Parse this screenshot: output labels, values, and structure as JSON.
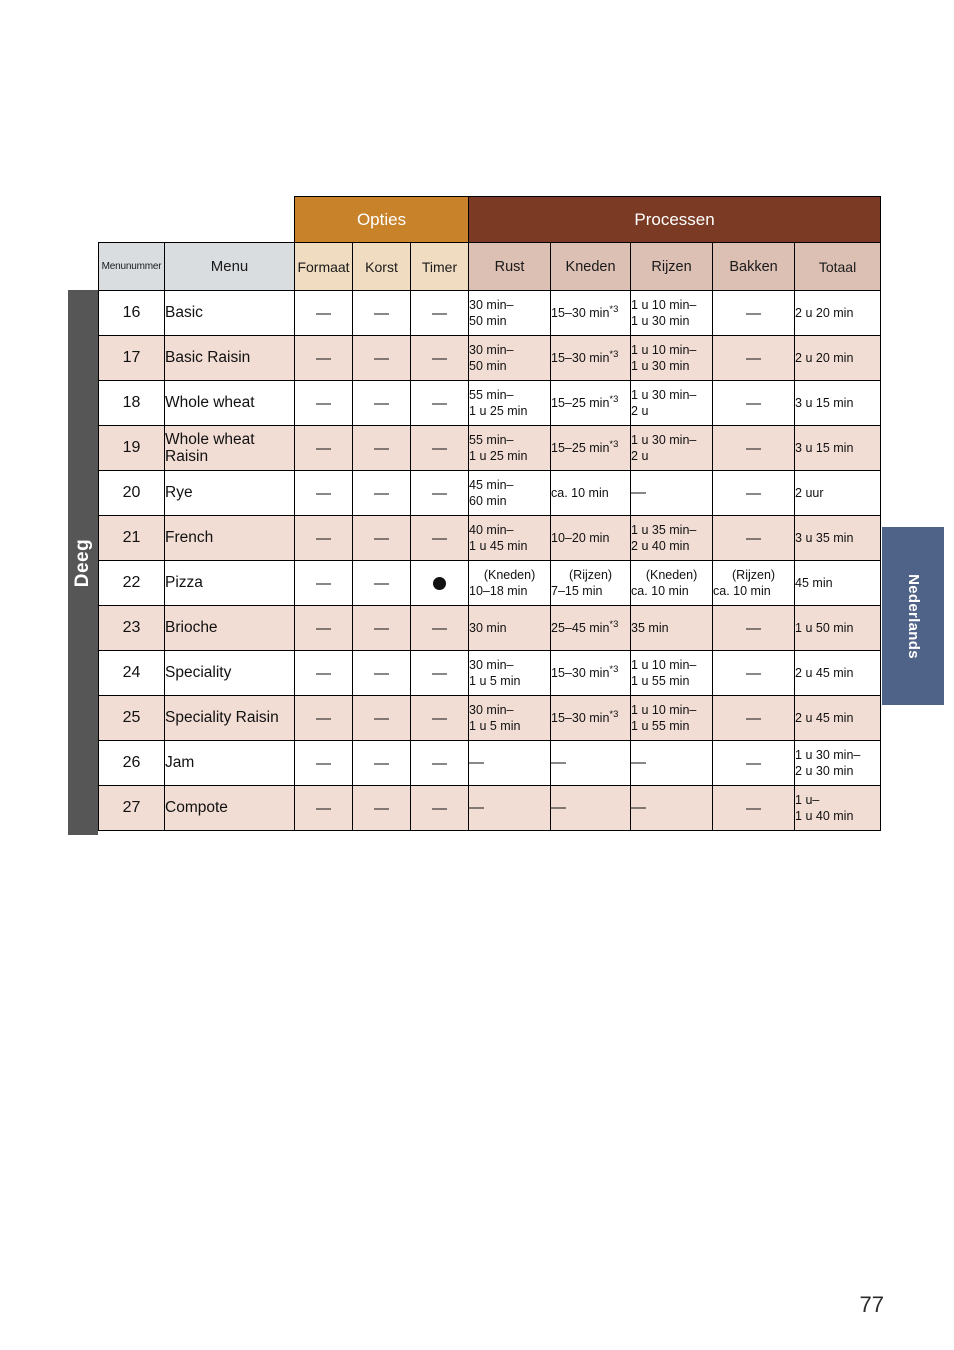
{
  "page": {
    "number": "77",
    "left_tab_label": "Deeg",
    "right_tab_label": "Nederlands",
    "colors": {
      "opties_header": "#c8822a",
      "processen_header": "#7a3a24",
      "menu_header": "#d9dde0",
      "opties_subheader": "#f0dcc0",
      "processen_subheader": "#dcc0b4",
      "row_alt": "#f2ddd5",
      "left_tab": "#565656",
      "right_tab": "#4f6287"
    }
  },
  "table": {
    "group_headers": {
      "blank": "",
      "opties": "Opties",
      "processen": "Processen"
    },
    "columns": [
      {
        "key": "menunummer",
        "label": "Menunummer"
      },
      {
        "key": "menu",
        "label": "Menu"
      },
      {
        "key": "formaat",
        "label": "Formaat"
      },
      {
        "key": "korst",
        "label": "Korst"
      },
      {
        "key": "timer",
        "label": "Timer"
      },
      {
        "key": "rust",
        "label": "Rust"
      },
      {
        "key": "kneden",
        "label": "Kneden"
      },
      {
        "key": "rijzen",
        "label": "Rijzen"
      },
      {
        "key": "bakken",
        "label": "Bakken"
      },
      {
        "key": "totaal",
        "label": "Totaal"
      }
    ],
    "rows": [
      {
        "num": "16",
        "menu": "Basic",
        "formaat": "—",
        "korst": "—",
        "timer": "—",
        "rust_l1": "30 min–",
        "rust_l2": "50 min",
        "kneden_l1": "15–30 min",
        "kneden_star": "*3",
        "kneden_l2": "",
        "rijzen_l1": "1 u 10 min–",
        "rijzen_l2": "1 u 30 min",
        "bakken": "—",
        "totaal_l1": "2 u 20 min",
        "totaal_l2": ""
      },
      {
        "num": "17",
        "menu": "Basic Raisin",
        "formaat": "—",
        "korst": "—",
        "timer": "—",
        "rust_l1": "30 min–",
        "rust_l2": "50 min",
        "kneden_l1": "15–30 min",
        "kneden_star": "*3",
        "kneden_l2": "",
        "rijzen_l1": "1 u 10 min–",
        "rijzen_l2": "1 u 30 min",
        "bakken": "—",
        "totaal_l1": "2 u 20 min",
        "totaal_l2": ""
      },
      {
        "num": "18",
        "menu": "Whole wheat",
        "formaat": "—",
        "korst": "—",
        "timer": "—",
        "rust_l1": "55 min–",
        "rust_l2": "1 u 25 min",
        "kneden_l1": "15–25 min",
        "kneden_star": "*3",
        "kneden_l2": "",
        "rijzen_l1": "1 u 30 min–",
        "rijzen_l2": "2 u",
        "bakken": "—",
        "totaal_l1": "3 u 15 min",
        "totaal_l2": ""
      },
      {
        "num": "19",
        "menu": "Whole wheat Raisin",
        "formaat": "—",
        "korst": "—",
        "timer": "—",
        "rust_l1": "55 min–",
        "rust_l2": "1 u 25 min",
        "kneden_l1": "15–25 min",
        "kneden_star": "*3",
        "kneden_l2": "",
        "rijzen_l1": "1 u 30 min–",
        "rijzen_l2": "2 u",
        "bakken": "—",
        "totaal_l1": "3 u 15 min",
        "totaal_l2": ""
      },
      {
        "num": "20",
        "menu": "Rye",
        "formaat": "—",
        "korst": "—",
        "timer": "—",
        "rust_l1": "45 min–",
        "rust_l2": "60 min",
        "kneden_l1": "ca. 10 min",
        "kneden_star": "",
        "kneden_l2": "",
        "rijzen_l1": "—",
        "rijzen_l2": "",
        "bakken": "—",
        "totaal_l1": "2 uur",
        "totaal_l2": ""
      },
      {
        "num": "21",
        "menu": "French",
        "formaat": "—",
        "korst": "—",
        "timer": "—",
        "rust_l1": "40 min–",
        "rust_l2": "1 u 45 min",
        "kneden_l1": "10–20 min",
        "kneden_star": "",
        "kneden_l2": "",
        "rijzen_l1": "1 u 35 min–",
        "rijzen_l2": "2 u 40 min",
        "bakken": "—",
        "totaal_l1": "3 u 35 min",
        "totaal_l2": ""
      },
      {
        "num": "22",
        "menu": "Pizza",
        "formaat": "—",
        "korst": "—",
        "timer": "●",
        "rust_l1": "(Kneden)",
        "rust_l2": "10–18 min",
        "kneden_l1": "(Rijzen)",
        "kneden_star": "",
        "kneden_l2": "7–15 min",
        "rijzen_l1": "(Kneden)",
        "rijzen_l2": "ca. 10 min",
        "bakken_l1": "(Rijzen)",
        "bakken_l2": "ca. 10 min",
        "bakken": "",
        "totaal_l1": "45 min",
        "totaal_l2": ""
      },
      {
        "num": "23",
        "menu": "Brioche",
        "formaat": "—",
        "korst": "—",
        "timer": "—",
        "rust_l1": "30 min",
        "rust_l2": "",
        "kneden_l1": "25–45 min",
        "kneden_star": "*3",
        "kneden_l2": "",
        "rijzen_l1": "35 min",
        "rijzen_l2": "",
        "bakken": "—",
        "totaal_l1": "1 u 50 min",
        "totaal_l2": ""
      },
      {
        "num": "24",
        "menu": "Speciality",
        "formaat": "—",
        "korst": "—",
        "timer": "—",
        "rust_l1": "30 min–",
        "rust_l2": "1 u 5 min",
        "kneden_l1": "15–30 min",
        "kneden_star": "*3",
        "kneden_l2": "",
        "rijzen_l1": "1 u 10 min–",
        "rijzen_l2": "1 u 55 min",
        "bakken": "—",
        "totaal_l1": "2 u 45 min",
        "totaal_l2": ""
      },
      {
        "num": "25",
        "menu": "Speciality Raisin",
        "formaat": "—",
        "korst": "—",
        "timer": "—",
        "rust_l1": "30 min–",
        "rust_l2": "1 u 5 min",
        "kneden_l1": "15–30 min",
        "kneden_star": "*3",
        "kneden_l2": "",
        "rijzen_l1": "1 u 10 min–",
        "rijzen_l2": "1 u 55 min",
        "bakken": "—",
        "totaal_l1": "2 u 45 min",
        "totaal_l2": ""
      },
      {
        "num": "26",
        "menu": "Jam",
        "formaat": "—",
        "korst": "—",
        "timer": "—",
        "rust_l1": "—",
        "rust_l2": "",
        "kneden_l1": "—",
        "kneden_star": "",
        "kneden_l2": "",
        "rijzen_l1": "—",
        "rijzen_l2": "",
        "bakken": "—",
        "totaal_l1": "1 u 30 min–",
        "totaal_l2": "2 u 30 min"
      },
      {
        "num": "27",
        "menu": "Compote",
        "formaat": "—",
        "korst": "—",
        "timer": "—",
        "rust_l1": "—",
        "rust_l2": "",
        "kneden_l1": "—",
        "kneden_star": "",
        "kneden_l2": "",
        "rijzen_l1": "—",
        "rijzen_l2": "",
        "bakken": "—",
        "totaal_l1": "1 u–",
        "totaal_l2": "1 u 40 min"
      }
    ]
  }
}
